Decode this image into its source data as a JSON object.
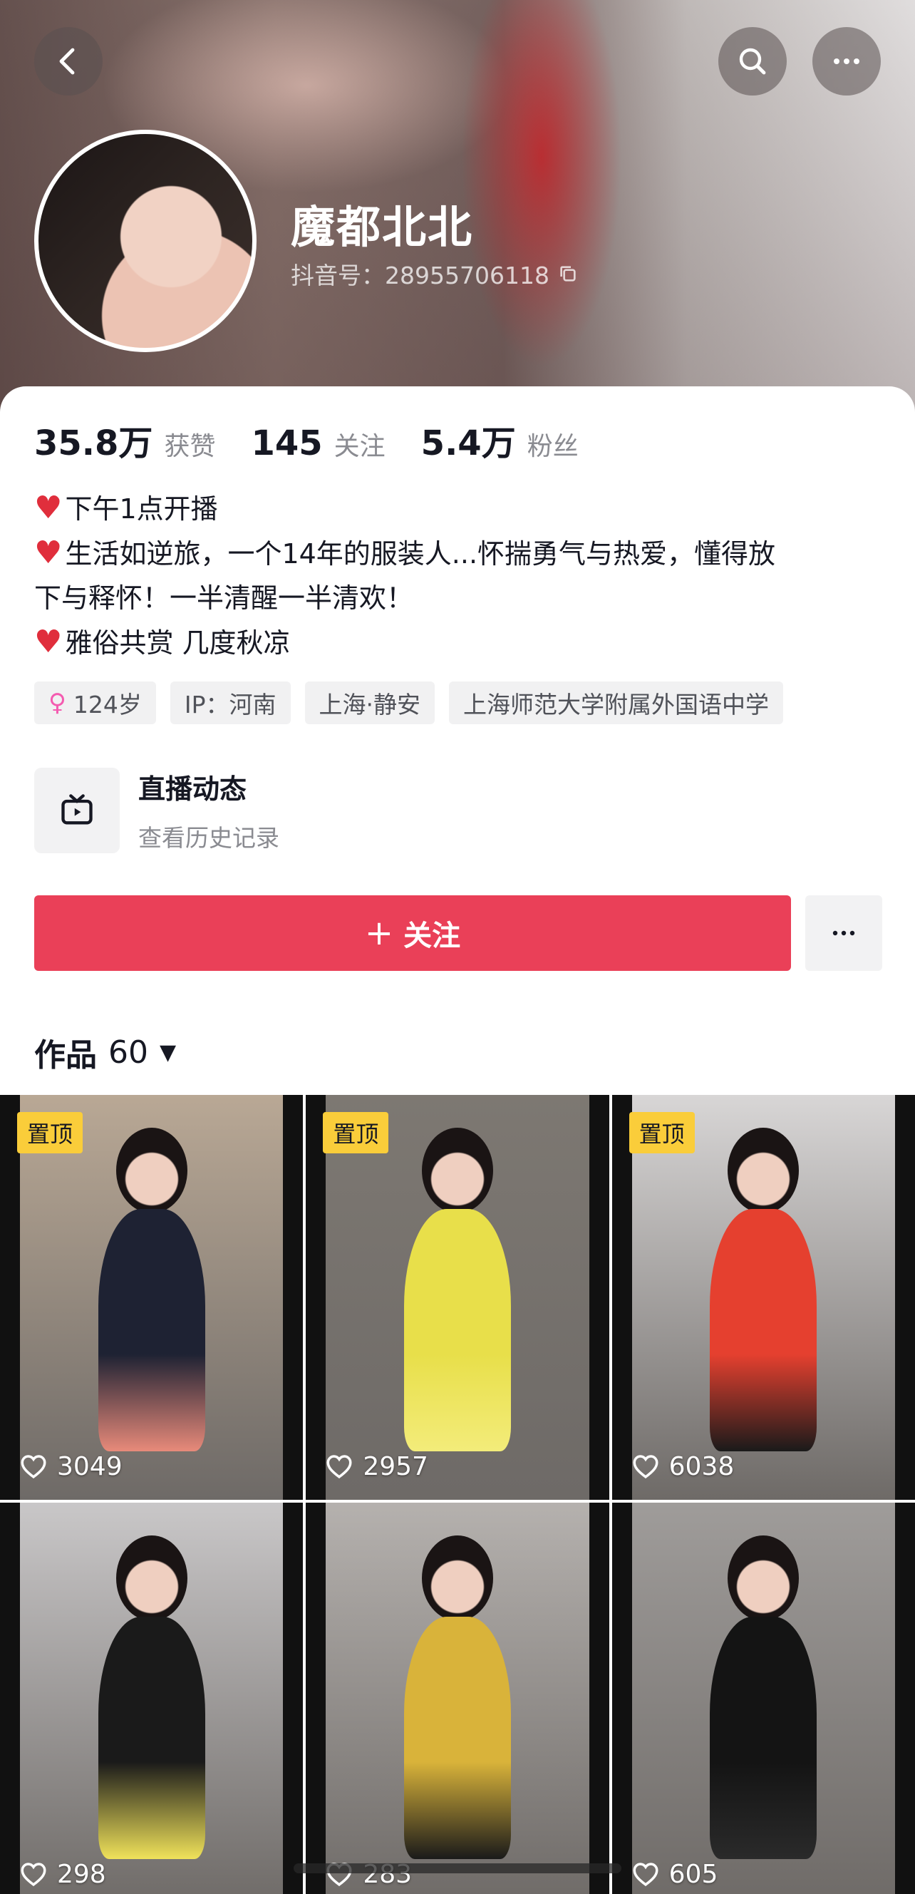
{
  "header": {
    "nickname": "魔都北北",
    "douyin_id": "抖音号：28955706118",
    "icons": [
      "back-arrow-icon",
      "search-icon",
      "more-icon",
      "copy-icon"
    ]
  },
  "stats": [
    {
      "value": "35.8万",
      "label": "获赞"
    },
    {
      "value": "145",
      "label": "关注"
    },
    {
      "value": "5.4万",
      "label": "粉丝"
    }
  ],
  "bio": [
    "下午1点开播",
    "生活如逆旅，一个14年的服装人...怀揣勇气与热爱，懂得放",
    "下与释怀！一半清醒一半清欢！",
    "雅俗共赏 几度秋凉"
  ],
  "tags": {
    "age": "124岁",
    "ip": "IP：河南",
    "location": "上海·静安",
    "school": "上海师范大学附属外国语中学"
  },
  "live": {
    "title": "直播动态",
    "subtitle": "查看历史记录"
  },
  "follow": {
    "label": "关注",
    "plus": "+"
  },
  "works": {
    "label": "作品",
    "count": "60",
    "caret": "▼"
  },
  "videos": [
    {
      "pinned": true,
      "pin_label": "置顶",
      "likes": "3049",
      "dress": "#1e2233",
      "accent": "#e88a7a",
      "bg": "#b9a895"
    },
    {
      "pinned": true,
      "pin_label": "置顶",
      "likes": "2957",
      "dress": "#e8df4a",
      "accent": "#f3ec7a",
      "bg": "#7d7872"
    },
    {
      "pinned": true,
      "pin_label": "置顶",
      "likes": "6038",
      "dress": "#e5402f",
      "accent": "#1a1a1a",
      "bg": "#d8d6d6"
    },
    {
      "pinned": false,
      "pin_label": "",
      "likes": "298",
      "dress": "#1a1a1a",
      "accent": "#f0e25a",
      "bg": "#c9c7c8"
    },
    {
      "pinned": false,
      "pin_label": "",
      "likes": "283",
      "dress": "#d9b33a",
      "accent": "#1a1a1a",
      "bg": "#b5b1ae"
    },
    {
      "pinned": false,
      "pin_label": "",
      "likes": "605",
      "dress": "#141414",
      "accent": "#2a2a2a",
      "bg": "#9f9c9a"
    }
  ]
}
